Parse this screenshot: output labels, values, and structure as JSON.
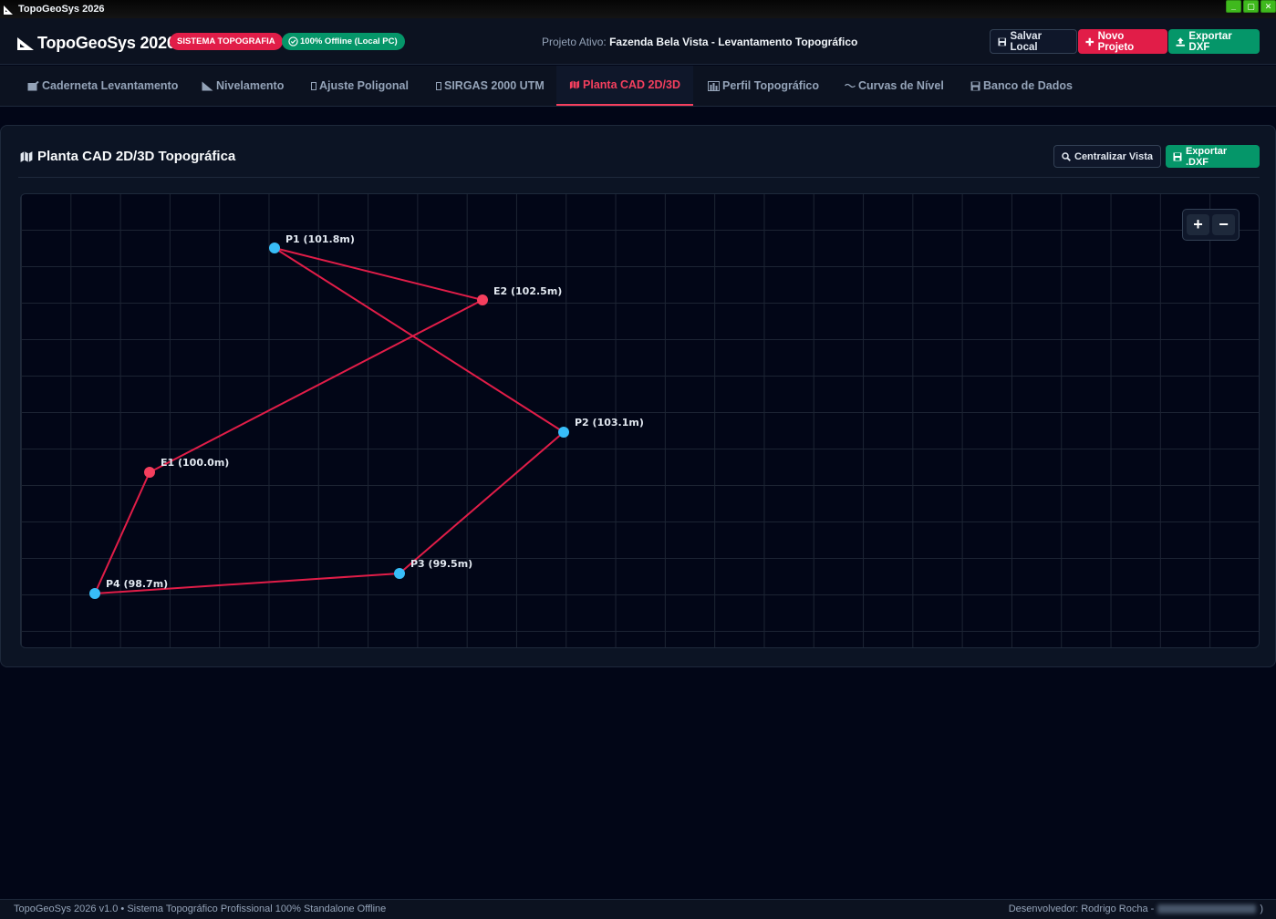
{
  "window": {
    "title": "TopoGeoSys 2026",
    "controls": [
      "_",
      "▢",
      "✕"
    ]
  },
  "header": {
    "brand": "TopoGeoSys 2026",
    "badge_system": "SISTEMA TOPOGRAFIA",
    "badge_offline": "100% Offline (Local PC)",
    "project_label": "Projeto Ativo:",
    "project_name": "Fazenda Bela Vista - Levantamento Topográfico",
    "btn_save": "Salvar Local",
    "btn_new": "Novo Projeto",
    "btn_export": "Exportar DXF"
  },
  "tabs": [
    {
      "label": "Caderneta Levantamento",
      "icon": "notebook-icon",
      "active": false
    },
    {
      "label": "Nivelamento",
      "icon": "ruler-icon",
      "active": false
    },
    {
      "label": "Ajuste Poligonal",
      "icon": "placeholder-icon",
      "active": false
    },
    {
      "label": "SIRGAS 2000 UTM",
      "icon": "placeholder-icon",
      "active": false
    },
    {
      "label": "Planta CAD 2D/3D",
      "icon": "map-icon",
      "active": true
    },
    {
      "label": "Perfil Topográfico",
      "icon": "chart-icon",
      "active": false
    },
    {
      "label": "Curvas de Nível",
      "icon": "wave-icon",
      "active": false
    },
    {
      "label": "Banco de Dados",
      "icon": "floppy-icon",
      "active": false
    }
  ],
  "panel": {
    "title": "Planta CAD 2D/3D Topográfica",
    "btn_center": "Centralizar Vista",
    "btn_export": "Exportar .DXF",
    "zoom_in": "+",
    "zoom_out": "−"
  },
  "plot": {
    "points": [
      {
        "label": "P1 (101.8m)",
        "kind": "station"
      },
      {
        "label": "E2 (102.5m)",
        "kind": "benchmark"
      },
      {
        "label": "P2 (103.1m)",
        "kind": "station"
      },
      {
        "label": "E1 (100.0m)",
        "kind": "benchmark"
      },
      {
        "label": "P3 (99.5m)",
        "kind": "station"
      },
      {
        "label": "P4 (98.7m)",
        "kind": "station"
      }
    ],
    "colors": {
      "station": "#38bdf8",
      "benchmark": "#f43f5e",
      "line": "#e11d48"
    }
  },
  "footer": {
    "left": "TopoGeoSys 2026 v1.0 • Sistema Topográfico Profissional 100% Standalone Offline",
    "right": "Desenvolvedor: Rodrigo Rocha -"
  }
}
